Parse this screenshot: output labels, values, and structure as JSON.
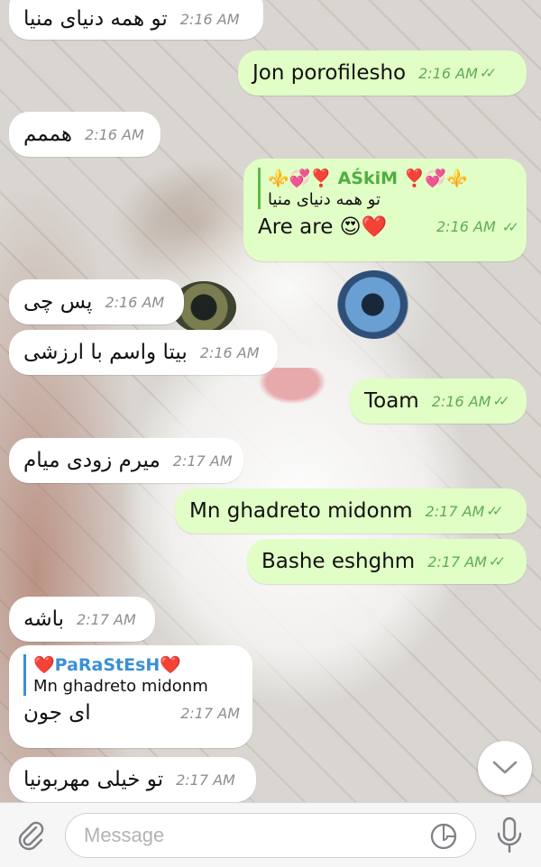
{
  "messages": [
    {
      "id": "m1",
      "dir": "in",
      "text": "تو همه دنیای منیا",
      "time": "2:16 AM"
    },
    {
      "id": "m2",
      "dir": "out",
      "text": "Jon porofilesho",
      "time": "2:16 AM"
    },
    {
      "id": "m3",
      "dir": "in",
      "text": "هممم",
      "time": "2:16 AM"
    },
    {
      "id": "m4",
      "dir": "out",
      "reply_to_name": "⚜️💞❣️ AŚkiM ❣️💞⚜️",
      "reply_to_text": "تو همه دنیای منیا",
      "text": "Are are 😍❤️",
      "time": "2:16 AM"
    },
    {
      "id": "m5",
      "dir": "in",
      "text": "پس چی",
      "time": "2:16 AM"
    },
    {
      "id": "m6",
      "dir": "in",
      "text": "بیتا واسم با ارزشی",
      "time": "2:16 AM"
    },
    {
      "id": "m7",
      "dir": "out",
      "text": "Toam",
      "time": "2:16 AM"
    },
    {
      "id": "m8",
      "dir": "in",
      "text": "میرم زودی میام",
      "time": "2:17 AM"
    },
    {
      "id": "m9",
      "dir": "out",
      "text": "Mn ghadreto midonm",
      "time": "2:17 AM"
    },
    {
      "id": "m10",
      "dir": "out",
      "text": "Bashe eshghm",
      "time": "2:17 AM"
    },
    {
      "id": "m11",
      "dir": "in",
      "text": "باشه",
      "time": "2:17 AM"
    },
    {
      "id": "m12",
      "dir": "in",
      "reply_to_name": "❤️PaRaStEsH❤️",
      "reply_to_text": "Mn ghadreto midonm",
      "text": "ای جون",
      "time": "2:17 AM"
    },
    {
      "id": "m13",
      "dir": "in",
      "text": "تو خیلی مهربونیا",
      "time": "2:17 AM"
    }
  ],
  "read_ticks": "✓✓",
  "composer": {
    "placeholder": "Message",
    "attach_icon": "paperclip-icon",
    "sticker_icon": "sticker-icon",
    "mic_icon": "microphone-icon"
  },
  "scroll_down_icon": "chevron-down-icon",
  "colors": {
    "incoming_bubble": "#ffffff",
    "outgoing_bubble": "#e1fec6",
    "outgoing_time": "#5fac54",
    "incoming_time": "#8e8e93",
    "reply_accent_out": "#4fae3f",
    "reply_accent_in": "#3a8fd8"
  }
}
